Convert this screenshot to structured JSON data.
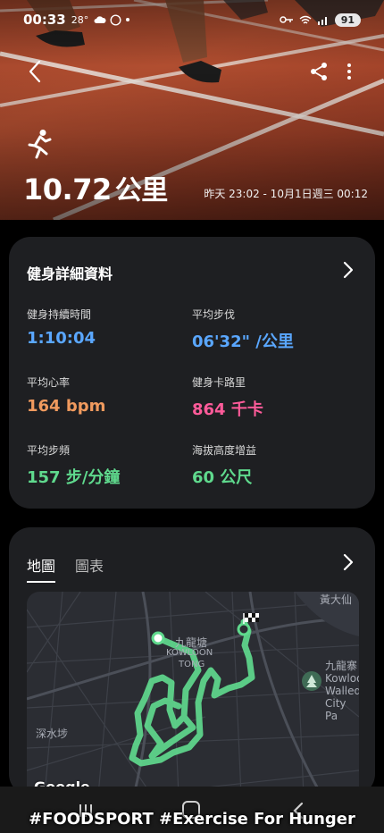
{
  "status_bar": {
    "time": "00:33",
    "temp": "28°",
    "battery": "91"
  },
  "hero": {
    "distance_value": "10.72",
    "distance_unit": "公里",
    "timestamp": "昨天 23:02 - 10月1日週三 00:12"
  },
  "details": {
    "title": "健身詳細資料",
    "metrics": [
      {
        "label": "健身持續時間",
        "value": "1:10:04",
        "color": "#5aa7ff"
      },
      {
        "label": "平均步伐",
        "value": "06'32\" /公里",
        "color": "#5aa7ff"
      },
      {
        "label": "平均心率",
        "value": "164 bpm",
        "color": "#f09a5e"
      },
      {
        "label": "健身卡路里",
        "value": "864 千卡",
        "color": "#ff5b9a"
      },
      {
        "label": "平均步頻",
        "value": "157 步/分鐘",
        "color": "#5fd98d"
      },
      {
        "label": "海拔高度增益",
        "value": "60 公尺",
        "color": "#5fd98d"
      }
    ]
  },
  "map_card": {
    "tabs": [
      {
        "label": "地圖",
        "active": true
      },
      {
        "label": "圖表",
        "active": false
      }
    ],
    "map_labels": {
      "district_1": "黃大仙",
      "district_2": "九龍塘",
      "district_2_en_1": "KOWLOON",
      "district_2_en_2": "TONG",
      "district_3": "深水埗",
      "park_zh": "九龍寨",
      "park_en_1": "Kowloo",
      "park_en_2": "Walled",
      "park_en_3": "City Pa"
    },
    "google_logo": "Google",
    "route_color": "#5fd98d"
  },
  "footer": {
    "caption": "#FOODSPORT  #Exercise  For Hunger"
  }
}
